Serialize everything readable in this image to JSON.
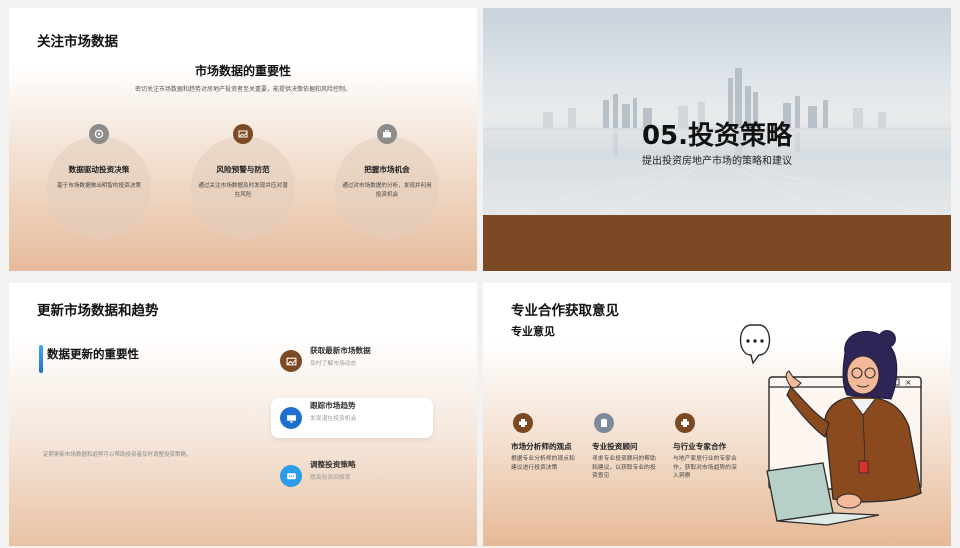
{
  "slide1": {
    "title": "关注市场数据",
    "subtitle": "市场数据的重要性",
    "description": "密切关注市场数据和趋势对房地产投资者至关重要，能提供决策依据和风险控制。",
    "items": [
      {
        "title": "数据驱动投资决策",
        "desc": "基于市场数据做出明智的投资决策",
        "icon": "target-icon",
        "color": "#8c8c8c"
      },
      {
        "title": "风险预警与防范",
        "desc": "通过关注市场数据及时发现并应对潜在风险",
        "icon": "image-icon",
        "color": "#7b4a24"
      },
      {
        "title": "把握市场机会",
        "desc": "通过对市场数据的分析，发现并利用投资机会",
        "icon": "briefcase-icon",
        "color": "#8c8c8c"
      }
    ]
  },
  "slide2": {
    "title": "05.投资策略",
    "subtitle": "提出投资房地产市场的策略和建议",
    "band_color": "#7b4a24"
  },
  "slide3": {
    "title": "更新市场数据和趋势",
    "section_title": "数据更新的重要性",
    "note": "定期更新市场数据和趋势可以帮助投资者及时调整投资策略。",
    "steps": [
      {
        "title": "获取最新市场数据",
        "desc": "及时了解市场动态",
        "icon": "image-icon",
        "color": "#7b4a24"
      },
      {
        "title": "跟踪市场趋势",
        "desc": "发现潜在投资机会",
        "icon": "monitor-icon",
        "color": "#1f6fd1"
      },
      {
        "title": "调整投资策略",
        "desc": "提高投资回报率",
        "icon": "chat-icon",
        "color": "#2b9de8"
      }
    ]
  },
  "slide4": {
    "title": "专业合作获取意见",
    "section_title": "专业意见",
    "columns": [
      {
        "title": "市场分析师的观点",
        "desc": "根据专业分析师的观点和建议进行投资决策",
        "icon": "printer-icon",
        "color": "#7b4a24"
      },
      {
        "title": "专业投资顾问",
        "desc": "寻求专业投资顾问的帮助和建议，以获取专业的投资意见",
        "icon": "clipboard-icon",
        "color": "#7d8a99"
      },
      {
        "title": "与行业专家合作",
        "desc": "与地产家居行业的专家合作，获取对市场趋势的深入洞察",
        "icon": "printer-icon",
        "color": "#7b4a24"
      }
    ]
  }
}
